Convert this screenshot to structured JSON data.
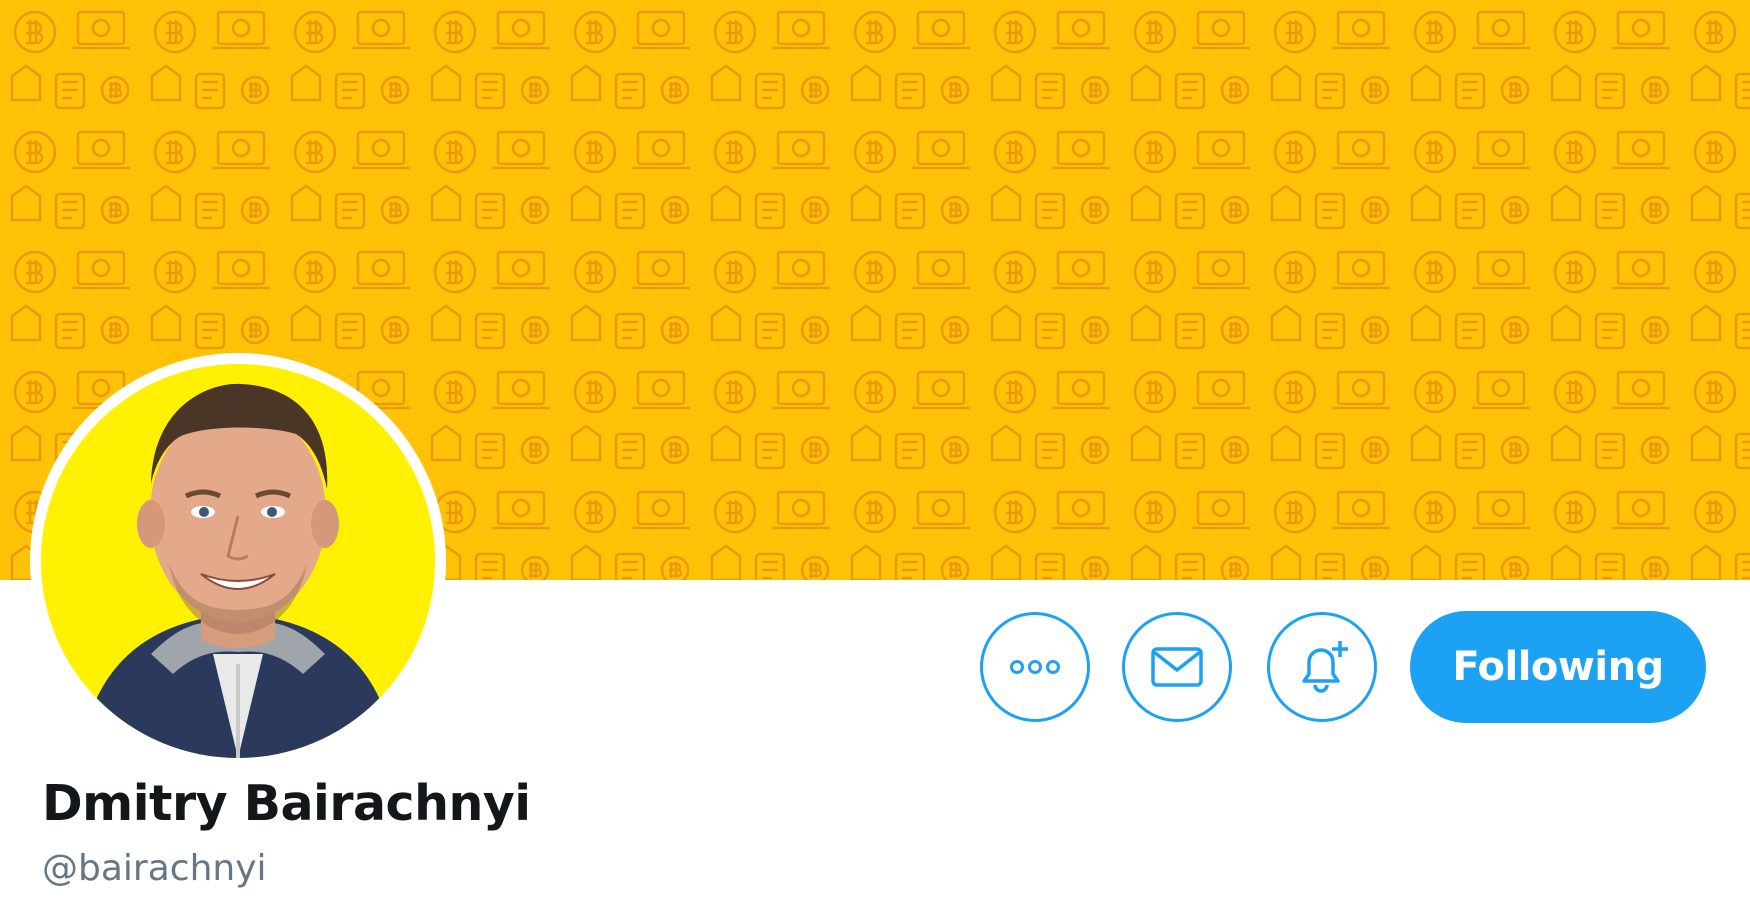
{
  "profile": {
    "display_name": "Dmitry Bairachnyi",
    "handle": "@bairachnyi"
  },
  "banner": {
    "background_color": "#ffc207",
    "pattern_color": "#e8920a",
    "pattern_motif": "bitcoin-icons"
  },
  "avatar": {
    "background_color": "#fff100"
  },
  "actions": {
    "more_icon": "more-dots-icon",
    "message_icon": "envelope-icon",
    "notify_icon": "bell-plus-icon",
    "following_label": "Following"
  },
  "colors": {
    "accent": "#1da1f2",
    "name_text": "#14171a",
    "handle_text": "#657786"
  }
}
